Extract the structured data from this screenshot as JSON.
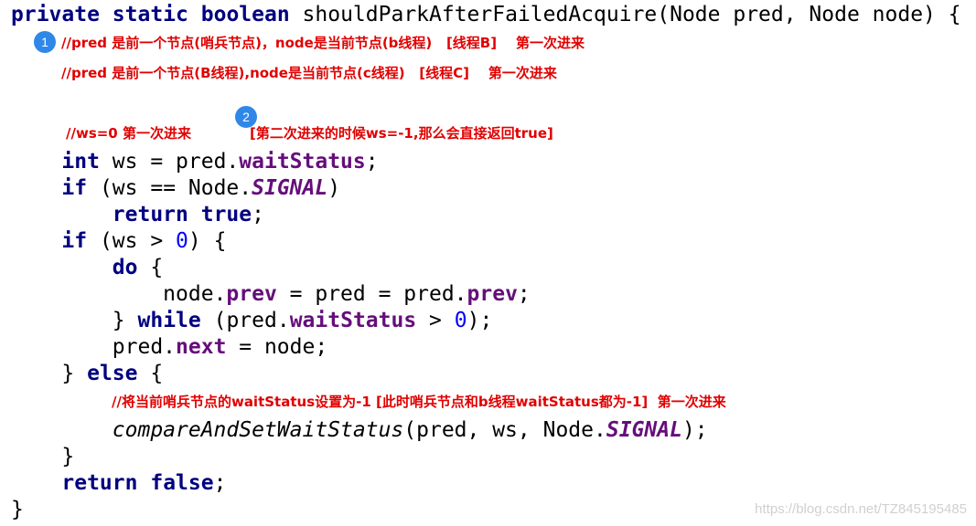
{
  "code": {
    "line1": {
      "kw_private": "private",
      "kw_static": "static",
      "kw_boolean": "boolean",
      "signature": "shouldParkAfterFailedAcquire(Node pred, Node node) {"
    },
    "line2": {
      "kw_int": "int",
      "pre": "ws = pred.",
      "field": "waitStatus",
      "post": ";"
    },
    "line3": {
      "kw_if": "if",
      "pre": "(ws == Node.",
      "const": "SIGNAL",
      "post": ")"
    },
    "line4": {
      "kw_return": "return",
      "kw_true": "true",
      "post": ";"
    },
    "line5": {
      "kw_if": "if",
      "pre": "(ws > ",
      "num": "0",
      "post": ") {"
    },
    "line6": {
      "kw_do": "do",
      "post": "{"
    },
    "line7": {
      "pre": "node.",
      "field1": "prev",
      "mid": " = pred = pred.",
      "field2": "prev",
      "post": ";"
    },
    "line8": {
      "pre": "}",
      "kw_while": "while",
      "mid": "(pred.",
      "field": "waitStatus",
      "mid2": " > ",
      "num": "0",
      "post": ");"
    },
    "line9": {
      "pre": "pred.",
      "field": "next",
      "post": " = node;"
    },
    "line10": {
      "pre": "}",
      "kw_else": "else",
      "post": "{"
    },
    "line11": {
      "method": "compareAndSetWaitStatus",
      "pre": "(pred, ws, Node.",
      "const": "SIGNAL",
      "post": ");"
    },
    "line12": {
      "text": "}"
    },
    "line13": {
      "kw_return": "return",
      "kw_false": "false",
      "post": ";"
    },
    "line14": {
      "text": "}"
    }
  },
  "comments": {
    "c1": "//pred 是前一个节点(哨兵节点)，node是当前节点(b线程)   [线程B]    第一次进来",
    "c2": "//pred 是前一个节点(B线程),node是当前节点(c线程)   [线程C]    第一次进来",
    "c3": "//ws=0 第一次进来",
    "c4": "[第二次进来的时候ws=-1,那么会直接返回true]",
    "c5": "//将当前哨兵节点的waitStatus设置为-1 [此时哨兵节点和b线程waitStatus都为-1]  第一次进来"
  },
  "badges": {
    "b1": "1",
    "b2": "2"
  },
  "watermark": "https://blog.csdn.net/TZ845195485",
  "colors": {
    "keyword": "#000080",
    "field": "#660e7a",
    "number": "#0000ff",
    "comment": "#e00000",
    "badge": "#2f88e8"
  }
}
